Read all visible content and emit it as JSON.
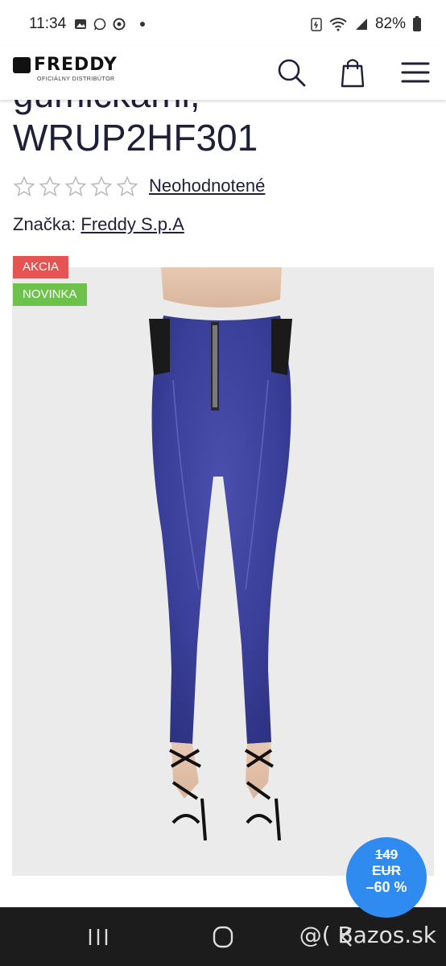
{
  "status_bar": {
    "time": "11:34",
    "battery": "82%"
  },
  "header": {
    "logo_text": "FREDDY",
    "logo_subtitle": "OFICIÁLNY DISTRIBÚTOR",
    "icons": [
      "search-icon",
      "shopping-bag-icon",
      "hamburger-menu-icon"
    ]
  },
  "product": {
    "title_partial": "gumičkami,",
    "title_code": "WRUP2HF301",
    "rating_text": "Neohodnotené",
    "brand_label": "Značka:",
    "brand_name": "Freddy S.p.A",
    "badges": {
      "akcia": "AKCIA",
      "novinka": "NOVINKA"
    },
    "price_old": "149",
    "currency": "EUR",
    "discount": "–60 %",
    "stars_total": 5,
    "stars_filled": 0
  },
  "colors": {
    "title": "#1f1f3a",
    "akcia": "#e55353",
    "novinka": "#6cc24a",
    "discount_bg": "#2f8bf0",
    "denim": "#3b3f9a"
  },
  "watermark": "@( Bazos.sk"
}
